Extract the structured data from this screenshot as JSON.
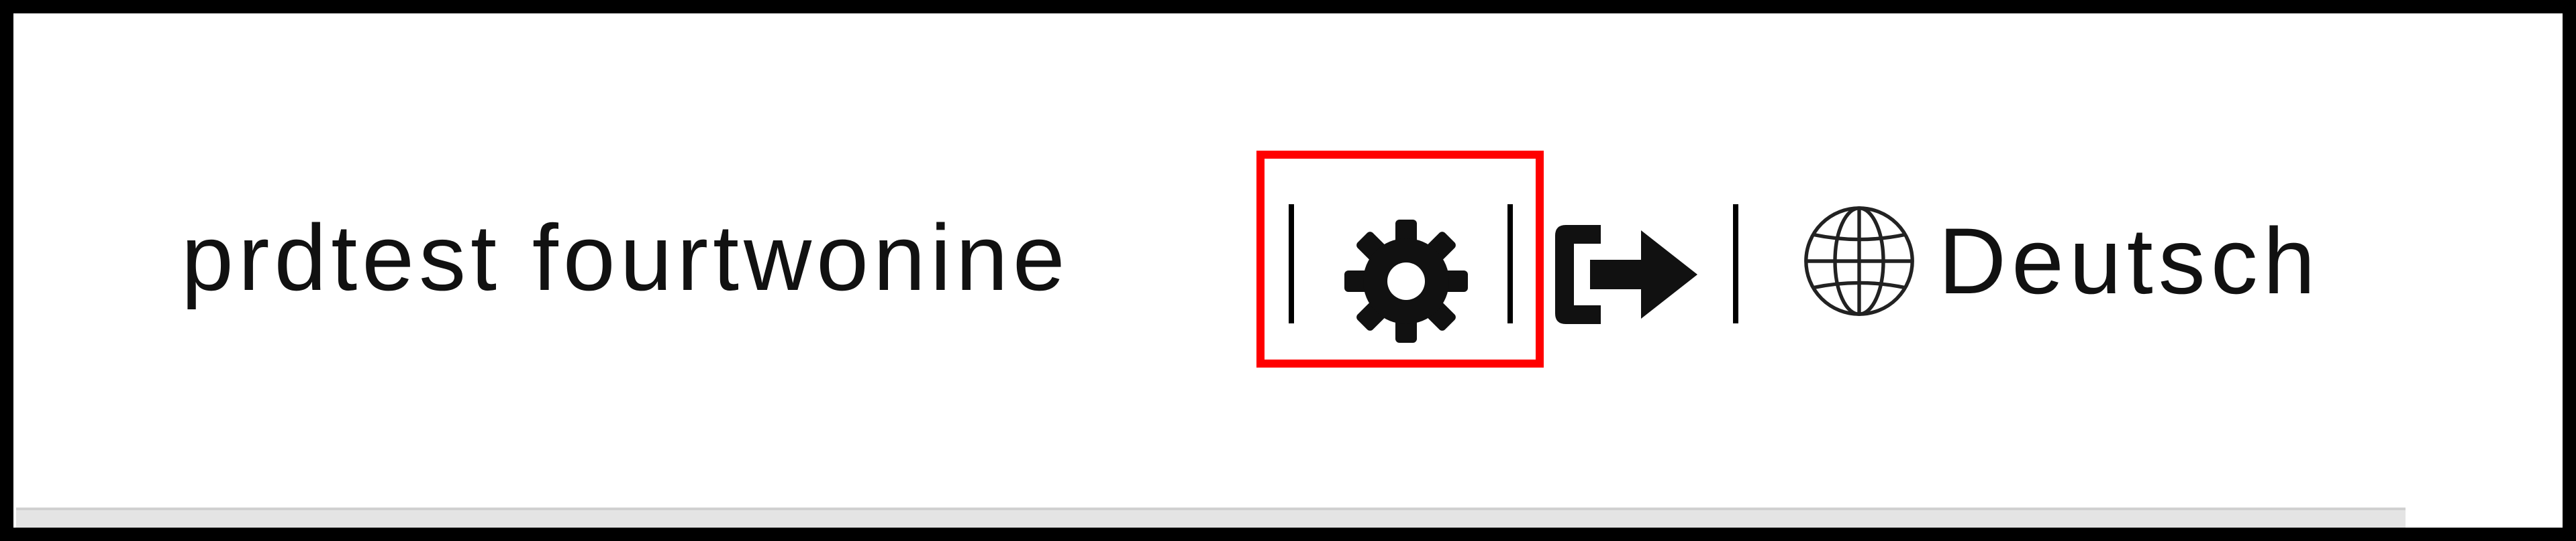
{
  "header": {
    "user_name": "prdtest fourtwonine",
    "separator": "|",
    "settings_icon": "gear-icon",
    "logout_icon": "sign-out-icon",
    "language": {
      "icon": "globe-icon",
      "label": "Deutsch"
    }
  },
  "annotation": {
    "highlight_color": "#ff0000",
    "highlighted_element": "settings-button"
  },
  "colors": {
    "text": "#111111",
    "background": "#ffffff",
    "frame": "#000000"
  }
}
